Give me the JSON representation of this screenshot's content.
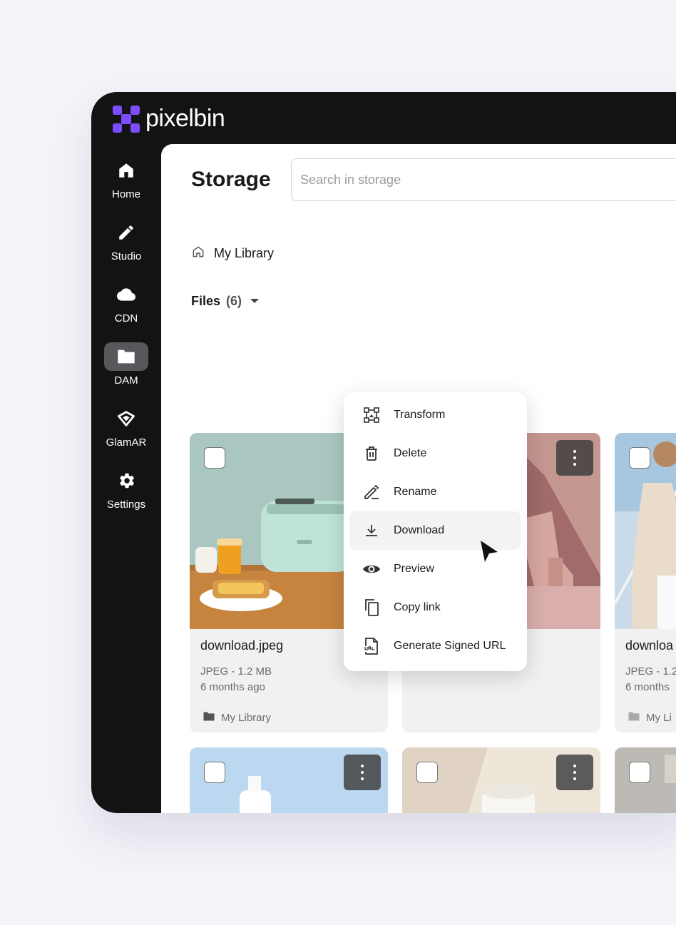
{
  "brand": {
    "name": "pixelbin",
    "accent": "#7c4dff"
  },
  "sidebar": {
    "items": [
      {
        "label": "Home",
        "icon": "home-icon"
      },
      {
        "label": "Studio",
        "icon": "pencil-icon"
      },
      {
        "label": "CDN",
        "icon": "cloud-icon"
      },
      {
        "label": "DAM",
        "icon": "folder-icon",
        "active": true
      },
      {
        "label": "GlamAR",
        "icon": "glamar-icon"
      },
      {
        "label": "Settings",
        "icon": "gear-icon"
      }
    ]
  },
  "header": {
    "title": "Storage",
    "search_placeholder": "Search in storage"
  },
  "breadcrumb": {
    "label": "My Library"
  },
  "files": {
    "label": "Files",
    "count": "(6)"
  },
  "cards": [
    {
      "name": "download.jpeg",
      "type_size": "JPEG - 1.2 MB",
      "age": "6 months ago",
      "folder": "My Library"
    },
    {
      "name": "",
      "type_size": "",
      "age": "",
      "folder": ""
    },
    {
      "name": "downloa",
      "type_size": "JPEG - 1.2",
      "age": "6 months",
      "folder": "My Li"
    }
  ],
  "context_menu": {
    "items": [
      {
        "label": "Transform",
        "icon": "transform-icon"
      },
      {
        "label": "Delete",
        "icon": "trash-icon"
      },
      {
        "label": "Rename",
        "icon": "rename-icon"
      },
      {
        "label": "Download",
        "icon": "download-icon",
        "hover": true
      },
      {
        "label": "Preview",
        "icon": "eye-icon"
      },
      {
        "label": "Copy link",
        "icon": "copy-icon"
      },
      {
        "label": "Generate Signed URL",
        "icon": "url-file-icon"
      }
    ]
  }
}
